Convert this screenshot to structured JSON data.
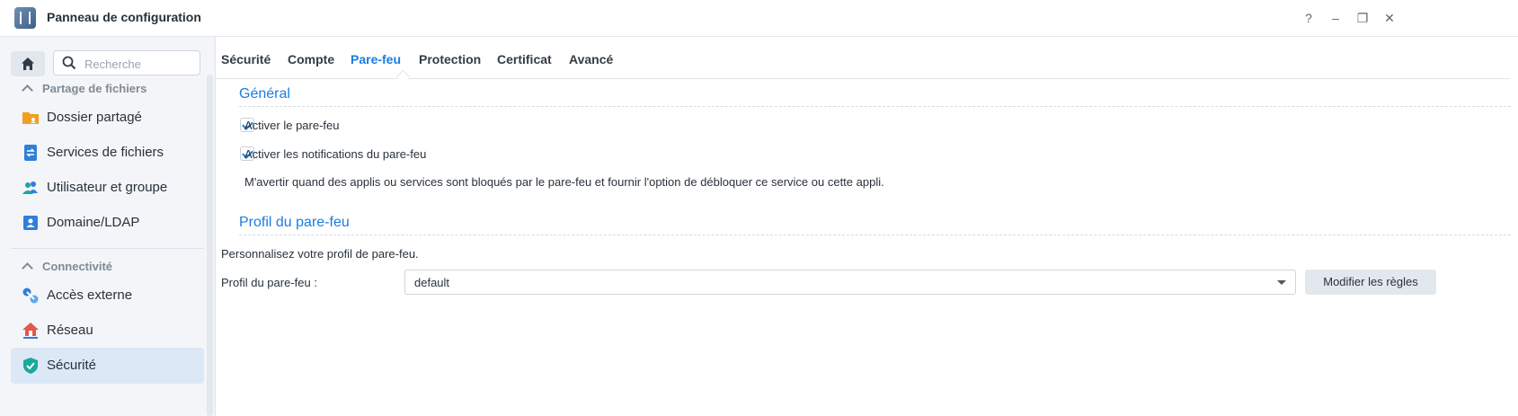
{
  "window": {
    "title": "Panneau de configuration",
    "controls": {
      "help": "?",
      "minimize": "–",
      "restore": "❐",
      "close": "✕"
    }
  },
  "sidebar": {
    "search_placeholder": "Recherche",
    "sections": [
      {
        "title": "Partage de fichiers",
        "items": [
          {
            "label": "Dossier partagé",
            "icon": "shared-folder-icon"
          },
          {
            "label": "Services de fichiers",
            "icon": "file-services-icon"
          },
          {
            "label": "Utilisateur et groupe",
            "icon": "user-group-icon"
          },
          {
            "label": "Domaine/LDAP",
            "icon": "domain-ldap-icon"
          }
        ]
      },
      {
        "title": "Connectivité",
        "items": [
          {
            "label": "Accès externe",
            "icon": "external-access-icon"
          },
          {
            "label": "Réseau",
            "icon": "network-icon"
          },
          {
            "label": "Sécurité",
            "icon": "security-shield-icon",
            "active": true
          }
        ]
      }
    ]
  },
  "tabs": [
    {
      "label": "Sécurité"
    },
    {
      "label": "Compte"
    },
    {
      "label": "Pare-feu",
      "active": true
    },
    {
      "label": "Protection"
    },
    {
      "label": "Certificat"
    },
    {
      "label": "Avancé"
    }
  ],
  "general": {
    "title": "Général",
    "enable_firewall": {
      "label": "Activer le pare-feu",
      "checked": true
    },
    "enable_notifications": {
      "label": "Activer les notifications du pare-feu",
      "checked": true
    },
    "notification_desc": "M'avertir quand des applis ou services sont bloqués par le pare-feu et fournir l'option de débloquer ce service ou cette appli."
  },
  "profile": {
    "title": "Profil du pare-feu",
    "desc": "Personnalisez votre profil de pare-feu.",
    "label": "Profil du pare-feu :",
    "value": "default",
    "edit_button": "Modifier les règles"
  },
  "colors": {
    "accent": "#1a7de0",
    "active_item_bg": "#dce8f6",
    "security_icon": "#1aa89b"
  }
}
